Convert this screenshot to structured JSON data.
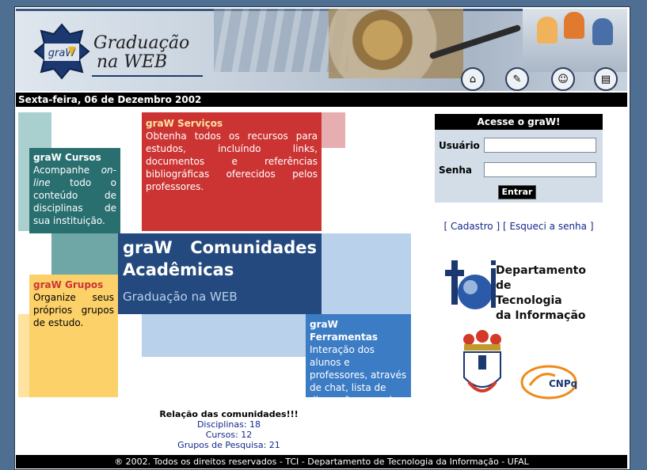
{
  "header": {
    "logo_mark": "graW",
    "logo_line1": "Graduação",
    "logo_line2": "na WEB",
    "nav_icons": [
      "home-icon",
      "edit-icon",
      "users-icon",
      "book-icon"
    ]
  },
  "date_text": "Sexta-feira, 06 de Dezembro 2002",
  "blocks": {
    "cursos": {
      "title": "graW Cursos",
      "lines": [
        "Acompanhe on-line todo o conteúdo de disciplinas de sua instituição."
      ]
    },
    "servicos": {
      "title": "graW Serviços",
      "text": "Obtenha todos os recursos para estudos, incluíndo links, documentos e referências bibliográficas oferecidos pelos professores."
    },
    "comunidades": {
      "title_line1": "graW Comunidades",
      "title_line2": "Acadêmicas",
      "subtitle": "Graduação na WEB"
    },
    "grupos": {
      "title": "graW Grupos",
      "text": "Organize seus próprios grupos de estudo."
    },
    "ferramentas": {
      "title": "graW Ferramentas",
      "text": "Interação dos alunos e professores, através de chat, lista de discussão, agenda e fórum."
    }
  },
  "login": {
    "title": "Acesse o graW!",
    "user_label": "Usuário",
    "pass_label": "Senha",
    "button": "Entrar"
  },
  "links": {
    "cadastro": "[ Cadastro ]",
    "esqueci": "[ Esqueci a senha ]"
  },
  "dept": {
    "line1": "Departamento de",
    "line2": "Tecnologia",
    "line3": "da Informação",
    "mark": "ti"
  },
  "cnpq": "CNPq",
  "communities": {
    "heading": "Relação das comunidades!!!",
    "disciplinas": "Disciplinas: 18",
    "cursos": "Cursos: 12",
    "grupos": "Grupos de Pesquisa: 21"
  },
  "footer": "® 2002. Todos os direitos reservados - TCI - Departamento de Tecnologia da Informação - UFAL",
  "colors": {
    "teal": "#2a6f70",
    "red": "#cc3434",
    "navy": "#23497e",
    "yellow": "#fcd16a",
    "blue": "#3c7cc5",
    "lightblue": "#b9d1ea"
  }
}
